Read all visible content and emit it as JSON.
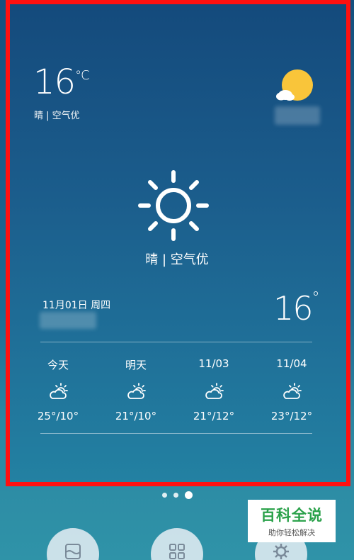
{
  "current": {
    "temp": "16",
    "unit": "°C",
    "description": "晴 | 空气优"
  },
  "main": {
    "description": "晴 | 空气优",
    "date": "11月01日 周四",
    "temp": "16",
    "degree": "°"
  },
  "forecast": [
    {
      "label": "今天",
      "temps": "25°/10°",
      "icon": "partly-cloudy-icon"
    },
    {
      "label": "明天",
      "temps": "21°/10°",
      "icon": "partly-cloudy-icon"
    },
    {
      "label": "11/03",
      "temps": "21°/12°",
      "icon": "partly-cloudy-icon"
    },
    {
      "label": "11/04",
      "temps": "23°/12°",
      "icon": "partly-cloudy-icon"
    }
  ],
  "pager": {
    "count": 3,
    "active": 3
  },
  "dock": [
    "weather-app-icon",
    "apps-grid-icon",
    "settings-gear-icon"
  ],
  "watermark": {
    "title": "百科全说",
    "subtitle": "助你轻松解决"
  },
  "colors": {
    "highlight_border": "#ff1010",
    "sun_yellow": "#f9c53a",
    "watermark_green": "#2aa14a"
  }
}
